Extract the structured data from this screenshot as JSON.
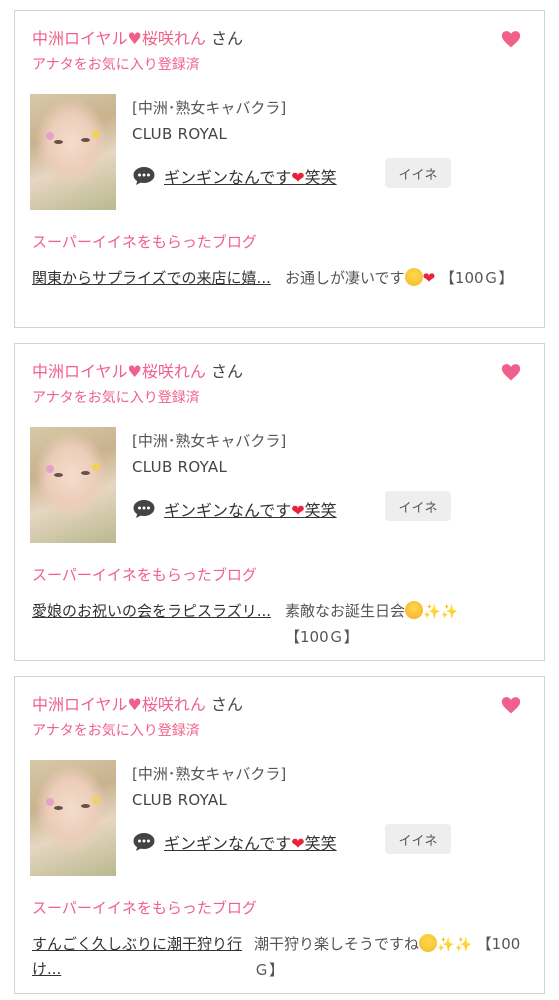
{
  "cards": [
    {
      "shop_name": "中洲ロイヤル♥桜咲れん",
      "san": "さん",
      "fav_label": "アナタをお気に入り登録済",
      "category": "[中洲･熟女キャバクラ]",
      "club": "CLUB ROYAL",
      "comment_pre": "ギンギンなんです",
      "comment_post": "笑笑",
      "iine": "イイネ",
      "super_label": "スーパーイイネをもらったブログ",
      "blog_title": "関東からサプライズでの来店に嬉...",
      "blog_desc_pre": "お通しが凄いです",
      "blog_desc_post": "【100Ｇ】"
    },
    {
      "shop_name": "中洲ロイヤル♥桜咲れん",
      "san": "さん",
      "fav_label": "アナタをお気に入り登録済",
      "category": "[中洲･熟女キャバクラ]",
      "club": "CLUB ROYAL",
      "comment_pre": "ギンギンなんです",
      "comment_post": "笑笑",
      "iine": "イイネ",
      "super_label": "スーパーイイネをもらったブログ",
      "blog_title": "愛娘のお祝いの会をラピスラズリ...",
      "blog_desc_pre": "素敵なお誕生日会",
      "blog_desc_post": "【100Ｇ】"
    },
    {
      "shop_name": "中洲ロイヤル♥桜咲れん",
      "san": "さん",
      "fav_label": "アナタをお気に入り登録済",
      "category": "[中洲･熟女キャバクラ]",
      "club": "CLUB ROYAL",
      "comment_pre": "ギンギンなんです",
      "comment_post": "笑笑",
      "iine": "イイネ",
      "super_label": "スーパーイイネをもらったブログ",
      "blog_title": "すんごく久しぶりに潮干狩り行け...",
      "blog_desc_pre": "潮干狩り楽しそうですね",
      "blog_desc_post": "【100Ｇ】"
    }
  ],
  "colors": {
    "accent_pink": "#f0608a",
    "heart_red": "#e8223a",
    "border": "#d2d2d2",
    "button_bg": "#eeeeee"
  },
  "icons": {
    "favorite": "heart-icon",
    "comment": "speech-bubble-icon"
  }
}
